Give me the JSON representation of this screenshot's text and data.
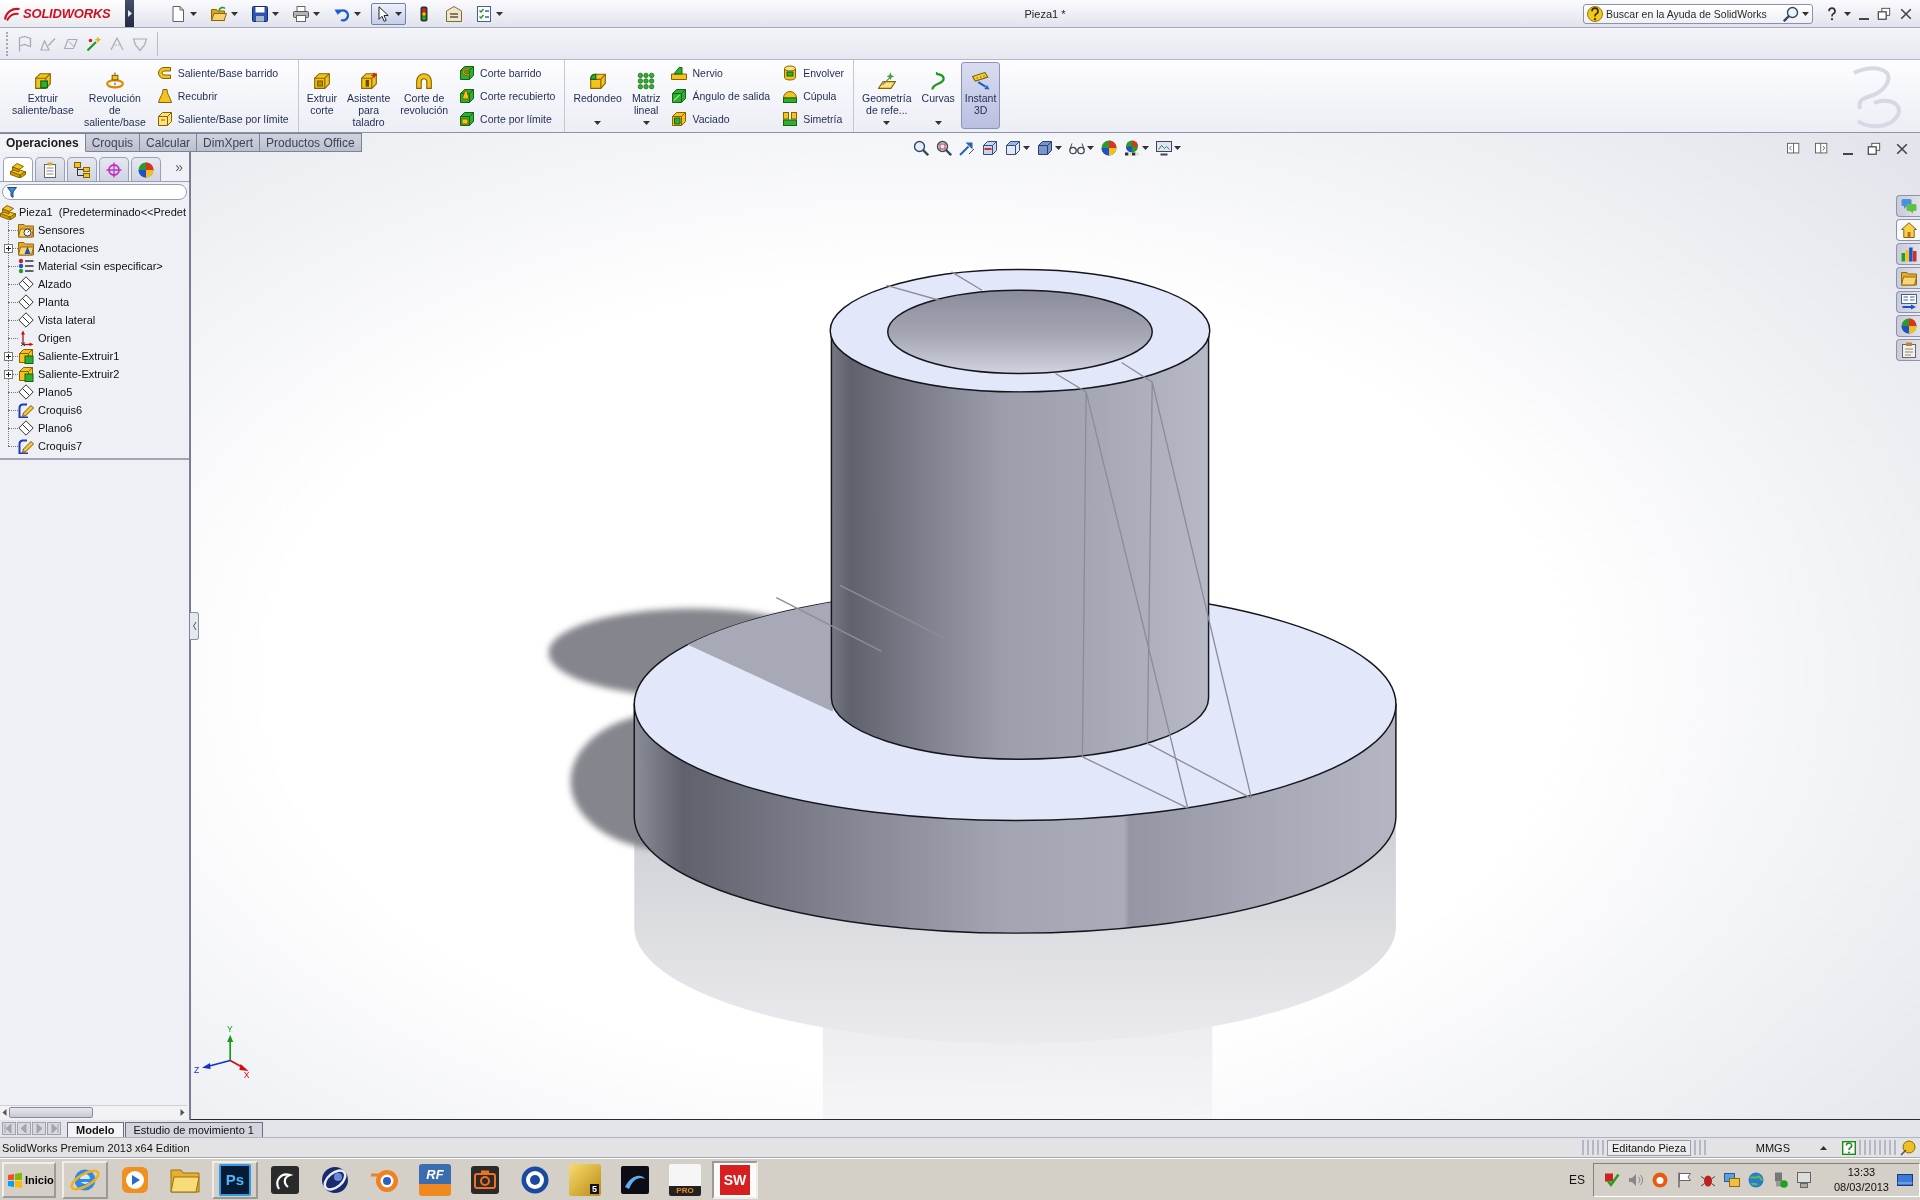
{
  "title_bar": {
    "brand": "SOLIDWORKS",
    "quick_access": [
      {
        "selected": false
      },
      {
        "selected": false
      },
      {
        "selected": false
      },
      {
        "selected": false
      },
      {
        "selected": false
      },
      {
        "selected": true
      },
      {
        "selected": false
      },
      {
        "selected": false
      },
      {
        "selected": false
      }
    ],
    "title": "Pieza1 *",
    "search": {
      "placeholder": "Buscar en la Ayuda de SolidWorks"
    }
  },
  "sketch_toolbar": [
    {
      "disabled": true
    },
    {
      "disabled": true
    },
    {
      "disabled": true
    },
    {
      "disabled": false
    },
    {
      "disabled": true
    },
    {
      "disabled": true
    }
  ],
  "command_manager": {
    "groups": [
      {
        "items": [
          {
            "kind": "large",
            "label": "Extruir\nsaliente/base",
            "dropdown": false,
            "selected": false
          },
          {
            "kind": "large",
            "label": "Revolución\nde\nsaliente/base",
            "dropdown": false,
            "selected": false
          },
          {
            "kind": "column",
            "labels": [
              "Saliente/Base barrido",
              "Recubrir",
              "Saliente/Base por límite"
            ]
          }
        ]
      },
      {
        "items": [
          {
            "kind": "large",
            "label": "Extruir\ncorte",
            "dropdown": false,
            "selected": false
          },
          {
            "kind": "large",
            "label": "Asistente\npara\ntaladro",
            "dropdown": false,
            "selected": false
          },
          {
            "kind": "large",
            "label": "Corte de\nrevolución",
            "dropdown": false,
            "selected": false
          },
          {
            "kind": "column",
            "labels": [
              "Corte barrido",
              "Corte recubierto",
              "Corte por límite"
            ]
          }
        ]
      },
      {
        "items": [
          {
            "kind": "large",
            "label": "Redondeo",
            "dropdown": true,
            "selected": false
          },
          {
            "kind": "large",
            "label": "Matriz\nlineal",
            "dropdown": true,
            "selected": false
          },
          {
            "kind": "column",
            "labels": [
              "Nervio",
              "Ángulo de salida",
              "Vaciado"
            ]
          },
          {
            "kind": "column",
            "labels": [
              "Envolver",
              "Cúpula",
              "Simetría"
            ]
          }
        ]
      },
      {
        "items": [
          {
            "kind": "large",
            "label": "Geometría\nde refe...",
            "dropdown": true,
            "selected": false
          },
          {
            "kind": "large",
            "label": "Curvas",
            "dropdown": true,
            "selected": false
          },
          {
            "kind": "large",
            "label": "Instant\n3D",
            "dropdown": false,
            "selected": true
          }
        ]
      }
    ]
  },
  "tabs": [
    {
      "label": "Operaciones",
      "selected": true
    },
    {
      "label": "Croquis",
      "selected": false
    },
    {
      "label": "Calcular",
      "selected": false
    },
    {
      "label": "DimXpert",
      "selected": false
    },
    {
      "label": "Productos Office",
      "selected": false
    }
  ],
  "feature_manager": {
    "tabs": [
      {
        "selected": true
      },
      {
        "selected": false
      },
      {
        "selected": false
      },
      {
        "selected": false
      },
      {
        "selected": false
      }
    ],
    "more": "»",
    "tree": {
      "label": "Pieza1  (Predeterminado<<Predet",
      "kind": "part",
      "children": [
        {
          "label": "Sensores",
          "kind": "sensors"
        },
        {
          "label": "Anotaciones",
          "kind": "annotations",
          "expanded": false
        },
        {
          "label": "Material <sin especificar>",
          "kind": "material"
        },
        {
          "label": "Alzado",
          "kind": "plane"
        },
        {
          "label": "Planta",
          "kind": "plane"
        },
        {
          "label": "Vista lateral",
          "kind": "plane"
        },
        {
          "label": "Origen",
          "kind": "origin"
        },
        {
          "label": "Saliente-Extruir1",
          "kind": "feature",
          "expanded": false
        },
        {
          "label": "Saliente-Extruir2",
          "kind": "feature",
          "expanded": false
        },
        {
          "label": "Plano5",
          "kind": "plane"
        },
        {
          "label": "Croquis6",
          "kind": "sketch"
        },
        {
          "label": "Plano6",
          "kind": "plane"
        },
        {
          "label": "Croquis7",
          "kind": "sketch"
        }
      ]
    }
  },
  "viewport": {
    "triad": {
      "x": "X",
      "y": "Y",
      "z": "Z"
    },
    "task_pane": [
      {
        "selected": false
      },
      {
        "selected": true
      },
      {
        "selected": false
      },
      {
        "selected": false
      },
      {
        "selected": false
      },
      {
        "selected": false
      },
      {
        "selected": false
      }
    ]
  },
  "model_tabs": [
    {
      "label": "Modelo",
      "selected": true
    },
    {
      "label": "Estudio de movimiento 1",
      "selected": false
    }
  ],
  "status_bar": {
    "product": "SolidWorks Premium 2013 x64 Edition",
    "mode": "Editando Pieza",
    "units": "MMGS"
  },
  "taskbar": {
    "start": "Inicio",
    "apps": [
      {
        "open": true,
        "selected": false
      },
      {
        "open": false,
        "selected": false
      },
      {
        "open": false,
        "selected": false
      },
      {
        "label": "Ps",
        "open": true,
        "selected": false
      },
      {
        "open": false,
        "selected": false
      },
      {
        "open": false,
        "selected": false
      },
      {
        "open": false,
        "selected": false
      },
      {
        "label": "RF",
        "open": false,
        "selected": false
      },
      {
        "open": false,
        "selected": false
      },
      {
        "open": false,
        "selected": false
      },
      {
        "label": "5",
        "open": false,
        "selected": false
      },
      {
        "open": false,
        "selected": false
      },
      {
        "label": "PRO",
        "open": false,
        "selected": false
      },
      {
        "label": "SW",
        "open": true,
        "selected": true
      }
    ],
    "language": "ES",
    "time": "13:33",
    "date": "08/03/2013"
  }
}
